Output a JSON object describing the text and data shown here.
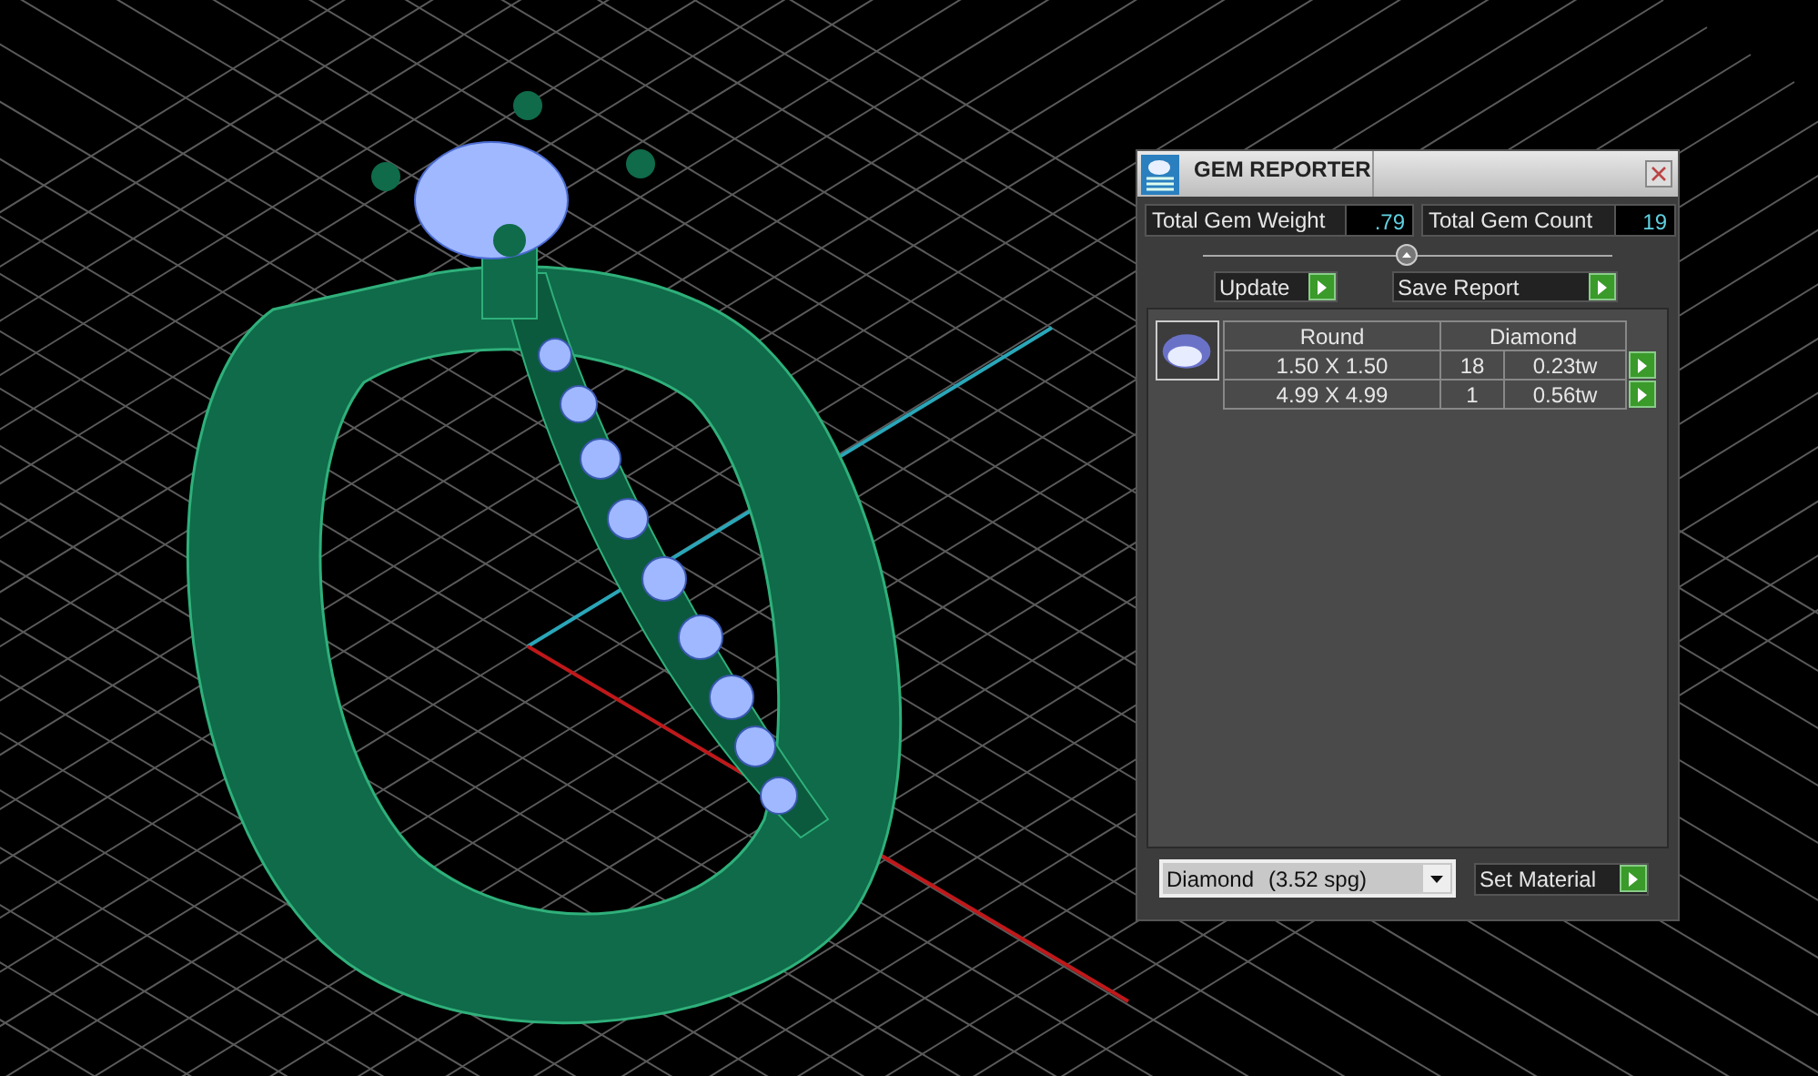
{
  "panel": {
    "title": "GEM REPORTER",
    "totals": [
      {
        "label": "Total Gem Weight",
        "value": ".79"
      },
      {
        "label": "Total Gem Count",
        "value": "19"
      }
    ],
    "buttons": [
      {
        "label": "Update",
        "kind": "short"
      },
      {
        "label": "Save Report",
        "kind": "wide"
      }
    ],
    "table": {
      "columns": [
        "Round",
        "Diamond"
      ],
      "rows": [
        {
          "size": "1.50 X 1.50",
          "count": "18",
          "weight": "0.23tw"
        },
        {
          "size": "4.99 X 4.99",
          "count": "1",
          "weight": "0.56tw"
        }
      ]
    },
    "material": {
      "value": "Diamond",
      "density": "(3.52 spg)"
    },
    "set_material": "Set Material"
  }
}
